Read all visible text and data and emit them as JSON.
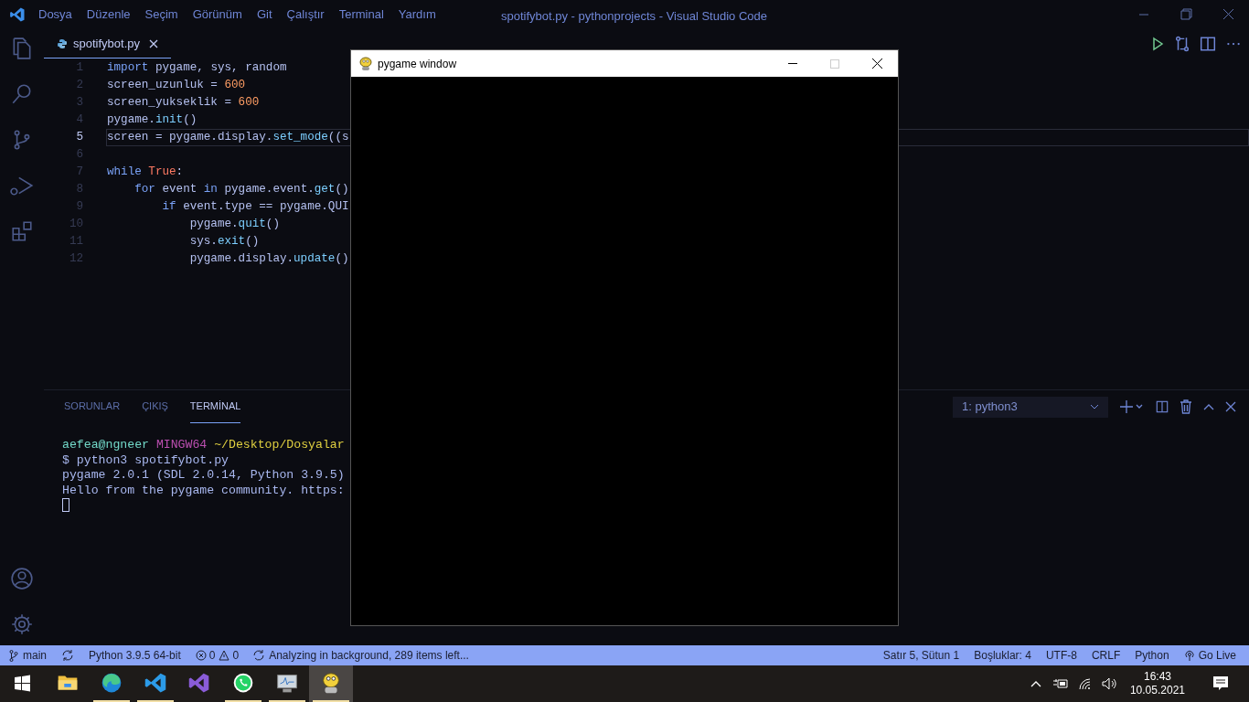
{
  "title_bar": {
    "menu": [
      "Dosya",
      "Düzenle",
      "Seçim",
      "Görünüm",
      "Git",
      "Çalıştır",
      "Terminal",
      "Yardım"
    ],
    "title": "spotifybot.py - pythonprojects - Visual Studio Code"
  },
  "editor_tabs": [
    {
      "label": "spotifybot.py",
      "selected": true
    }
  ],
  "code_lines": [
    {
      "number": "1",
      "current": false,
      "tokens": [
        {
          "kind": "keyword",
          "text": "import"
        },
        {
          "kind": "plain",
          "text": " pygame, sys, random"
        }
      ]
    },
    {
      "number": "2",
      "current": false,
      "tokens": [
        {
          "kind": "plain",
          "text": "screen_uzunluk = "
        },
        {
          "kind": "number",
          "text": "600"
        }
      ]
    },
    {
      "number": "3",
      "current": false,
      "tokens": [
        {
          "kind": "plain",
          "text": "screen_yukseklik = "
        },
        {
          "kind": "number",
          "text": "600"
        }
      ]
    },
    {
      "number": "4",
      "current": false,
      "tokens": [
        {
          "kind": "plain",
          "text": "pygame."
        },
        {
          "kind": "function",
          "text": "init"
        },
        {
          "kind": "plain",
          "text": "()"
        }
      ]
    },
    {
      "number": "5",
      "current": true,
      "tokens": [
        {
          "kind": "plain",
          "text": "screen = pygame.display."
        },
        {
          "kind": "function",
          "text": "set_mode"
        },
        {
          "kind": "plain",
          "text": "((s"
        }
      ]
    },
    {
      "number": "6",
      "current": false
    },
    {
      "number": "7",
      "current": false,
      "tokens": [
        {
          "kind": "keyword",
          "text": "while"
        },
        {
          "kind": "constant",
          "text": " True"
        },
        {
          "kind": "plain",
          "text": ":"
        }
      ]
    },
    {
      "number": "8",
      "current": false,
      "tokens": [
        {
          "kind": "keyword",
          "text": "    for"
        },
        {
          "kind": "plain",
          "text": " event "
        },
        {
          "kind": "keyword",
          "text": "in"
        },
        {
          "kind": "plain",
          "text": " pygame.event."
        },
        {
          "kind": "function",
          "text": "get"
        },
        {
          "kind": "plain",
          "text": "()"
        }
      ]
    },
    {
      "number": "9",
      "current": false,
      "tokens": [
        {
          "kind": "keyword",
          "text": "        if"
        },
        {
          "kind": "plain",
          "text": " event.type == pygame.QUI"
        }
      ]
    },
    {
      "number": "10",
      "current": false,
      "tokens": [
        {
          "kind": "plain",
          "text": "            pygame."
        },
        {
          "kind": "function",
          "text": "quit"
        },
        {
          "kind": "plain",
          "text": "()"
        }
      ]
    },
    {
      "number": "11",
      "current": false,
      "tokens": [
        {
          "kind": "plain",
          "text": "            sys."
        },
        {
          "kind": "function",
          "text": "exit"
        },
        {
          "kind": "plain",
          "text": "()"
        }
      ]
    },
    {
      "number": "12",
      "current": false,
      "tokens": [
        {
          "kind": "plain",
          "text": "            pygame.display."
        },
        {
          "kind": "function",
          "text": "update"
        },
        {
          "kind": "plain",
          "text": "()"
        }
      ]
    }
  ],
  "panel": {
    "tabs": [
      {
        "label": "SORUNLAR",
        "selected": false
      },
      {
        "label": "ÇIKIŞ",
        "selected": false
      },
      {
        "label": "TERMİNAL",
        "selected": true
      }
    ],
    "terminal_select": "1: python3",
    "terminal_lines": [
      [
        {
          "kind": "user",
          "text": "aefea@ngneer"
        },
        {
          "kind": "host",
          "text": " MINGW64"
        },
        {
          "kind": "path",
          "text": " ~/Desktop/Dosyalar"
        }
      ],
      [
        {
          "kind": "plain",
          "text": "$ python3 spotifybot.py"
        }
      ],
      [
        {
          "kind": "plain",
          "text": "pygame 2.0.1 (SDL 2.0.14, Python 3.9.5)"
        }
      ],
      [
        {
          "kind": "plain",
          "text": "Hello from the pygame community. https:"
        }
      ]
    ]
  },
  "pygame_window": {
    "title": "pygame window"
  },
  "status_bar": {
    "left": [
      {
        "kind": "branch",
        "text": "main"
      },
      {
        "kind": "sync"
      },
      {
        "kind": "text",
        "text": "Python 3.9.5 64-bit"
      },
      {
        "kind": "problems",
        "errors": "0",
        "warnings": "0"
      },
      {
        "kind": "analyzing",
        "text": "Analyzing in background, 289 items left..."
      }
    ],
    "right": [
      {
        "kind": "text",
        "text": "Satır 5, Sütun 1"
      },
      {
        "kind": "text",
        "text": "Boşluklar: 4"
      },
      {
        "kind": "text",
        "text": "UTF-8"
      },
      {
        "kind": "text",
        "text": "CRLF"
      },
      {
        "kind": "text",
        "text": "Python"
      },
      {
        "kind": "live",
        "text": "Go Live"
      }
    ]
  },
  "taskbar": {
    "apps": [
      {
        "kind": "files",
        "running": false,
        "selected": false
      },
      {
        "kind": "edge",
        "running": true,
        "selected": false
      },
      {
        "kind": "vscode",
        "running": true,
        "selected": false
      },
      {
        "kind": "visualstudio",
        "running": false,
        "selected": false
      },
      {
        "kind": "whatsapp",
        "running": true,
        "selected": false
      },
      {
        "kind": "monitor",
        "running": true,
        "selected": false
      },
      {
        "kind": "pygame",
        "running": true,
        "selected": true
      }
    ],
    "clock": {
      "time": "16:43",
      "date": "10.05.2021"
    }
  }
}
